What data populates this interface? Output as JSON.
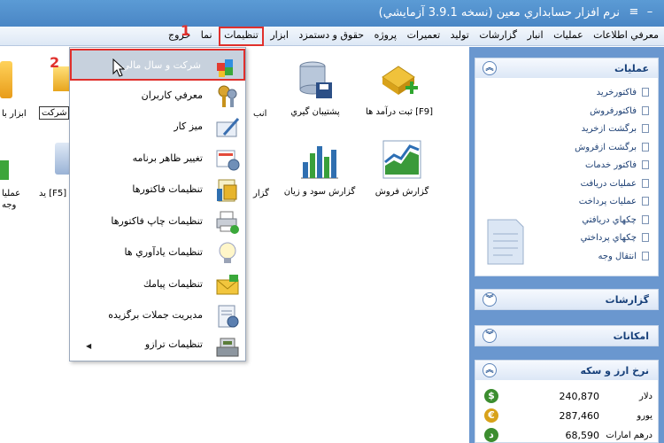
{
  "window": {
    "title": "نرم افزار حسابداري معين (نسخه 3.9.1 آزمايشي)"
  },
  "menubar": {
    "items": [
      "معرفي اطلاعات",
      "عمليات",
      "انبار",
      "گزارشات",
      "توليد",
      "تعميرات",
      "پروژه",
      "حقوق و دستمزد",
      "ابزار",
      "تنظيمات",
      "نما",
      "خروج"
    ]
  },
  "step_labels": [
    "1",
    "2"
  ],
  "desktop": {
    "icons": [
      {
        "label": "ثبت درآمد ها [F9]",
        "icon": "money-add-icon"
      },
      {
        "label": "پشتيبان گيري",
        "icon": "database-backup-icon"
      },
      {
        "label": "گزارش فروش",
        "icon": "sales-chart-icon"
      },
      {
        "label": "گزارش سود و زيان",
        "icon": "bar-chart-icon"
      }
    ],
    "partial_left": [
      "ابزار با",
      "شركت",
      "يد [F5]",
      "عمليا",
      "وجه",
      "انب",
      "گزار"
    ]
  },
  "dropdown": {
    "items": [
      {
        "label": "شركت و سال مالي",
        "icon": "company-cubes-icon",
        "highlighted": true
      },
      {
        "label": "معرفي كاربران",
        "icon": "user-keys-icon"
      },
      {
        "label": "ميز كار",
        "icon": "desktop-edit-icon"
      },
      {
        "label": "تغيير ظاهر برنامه",
        "icon": "appearance-icon"
      },
      {
        "label": "تنظيمات فاكتورها",
        "icon": "invoice-settings-icon"
      },
      {
        "label": "تنظيمات چاپ فاكتورها",
        "icon": "printer-icon"
      },
      {
        "label": "تنظيمات يادآوري ها",
        "icon": "lightbulb-icon"
      },
      {
        "label": "تنظيمات پيامك",
        "icon": "sms-envelope-icon"
      },
      {
        "label": "مديريت جملات برگزيده",
        "icon": "phrases-doc-icon"
      },
      {
        "label": "تنظيمات ترازو",
        "icon": "scale-icon",
        "has_submenu": true
      }
    ]
  },
  "panels": {
    "operations": {
      "title": "عمليات",
      "links": [
        "فاكتورخريد",
        "فاكتورفروش",
        "برگشت ازخريد",
        "برگشت ازفروش",
        "فاكتور خدمات",
        "عمليات دريافت",
        "عمليات پرداخت",
        "چكهاي دريافتي",
        "چكهاي پرداختي",
        "انتقال وجه"
      ]
    },
    "reports": {
      "title": "گزارشات"
    },
    "features": {
      "title": "امكانات"
    },
    "currency": {
      "title": "نرخ ارز و سكه",
      "rows": [
        {
          "name": "دلار",
          "value": "240,870",
          "color": "#3c8d2f",
          "symbol": "$"
        },
        {
          "name": "يورو",
          "value": "287,460",
          "color": "#d8a21a",
          "symbol": "€"
        },
        {
          "name": "درهم امارات",
          "value": "68,590",
          "color": "#3c8d2f",
          "symbol": "د"
        }
      ]
    }
  },
  "colors": {
    "accent_red": "#e0302c",
    "title_blue": "#4a86c5",
    "sidebar_blue": "#6a97cf"
  }
}
